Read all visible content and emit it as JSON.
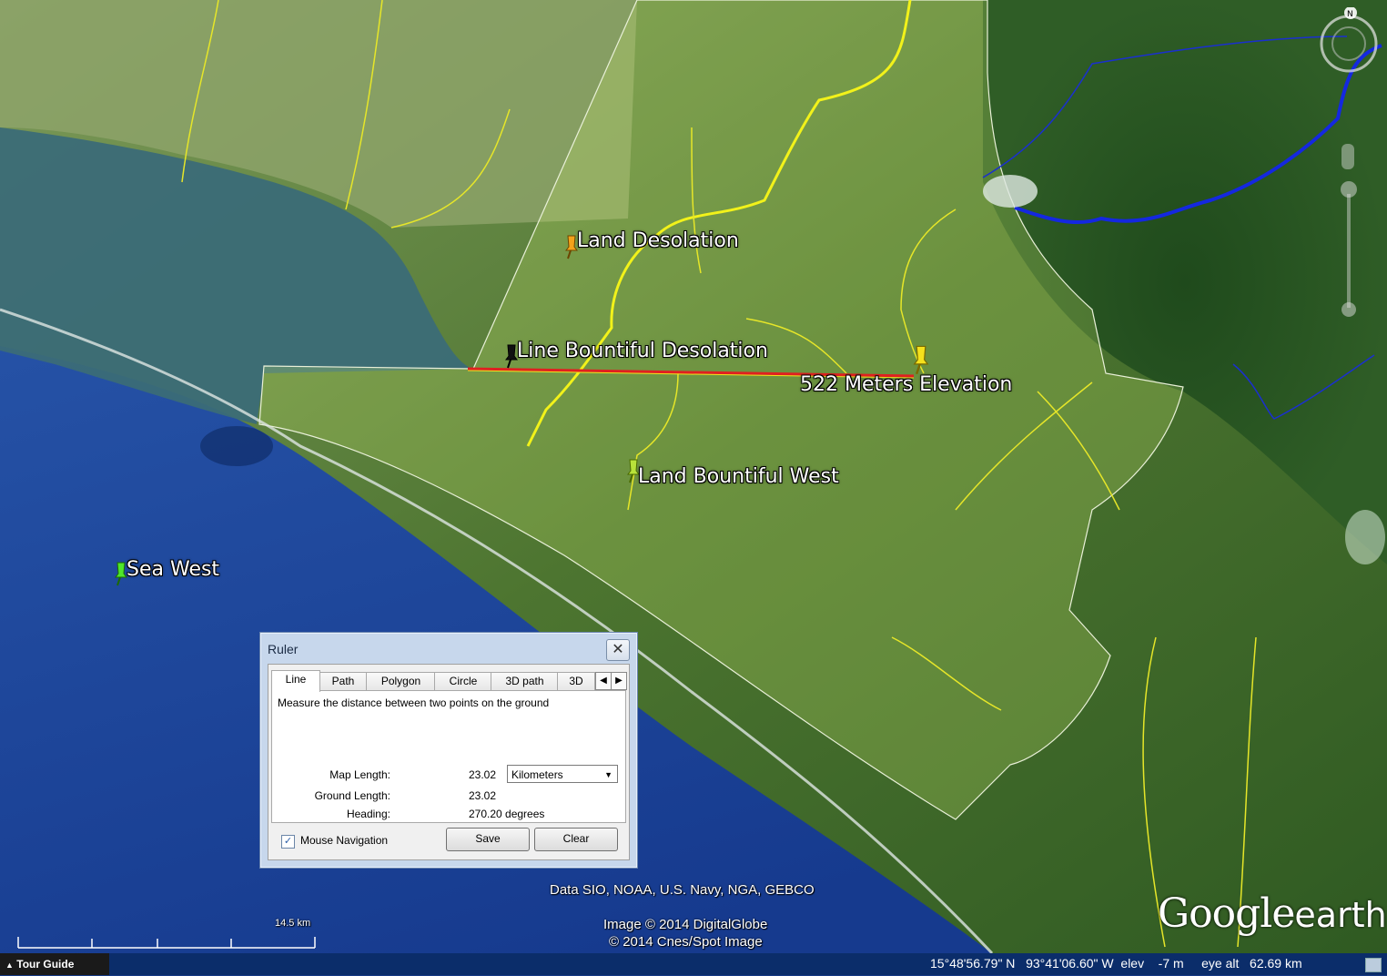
{
  "placemarks": {
    "land_desolation": "Land Desolation",
    "line_bountiful_desolation": "Line Bountiful Desolation",
    "elevation": "522 Meters Elevation",
    "land_bountiful_west": "Land Bountiful West",
    "sea_west": "Sea West"
  },
  "pin_colors": {
    "land_desolation": "#f3a21b",
    "line_bountiful_desolation": "#111111",
    "elevation": "#f5e11c",
    "land_bountiful_west": "#b8e23a",
    "sea_west": "#4ee62a"
  },
  "ruler": {
    "title": "Ruler",
    "close_icon": "close-icon",
    "tabs": [
      "Line",
      "Path",
      "Polygon",
      "Circle",
      "3D path",
      "3D"
    ],
    "active_tab": "Line",
    "description": "Measure the distance between two points on the ground",
    "map_length_label": "Map Length:",
    "map_length_value": "23.02",
    "unit_selected": "Kilometers",
    "ground_length_label": "Ground Length:",
    "ground_length_value": "23.02",
    "heading_label": "Heading:",
    "heading_value": "270.20 degrees",
    "mouse_navigation_label": "Mouse Navigation",
    "mouse_navigation_checked": true,
    "save_label": "Save",
    "clear_label": "Clear"
  },
  "credits": {
    "data": "Data SIO, NOAA, U.S. Navy, NGA, GEBCO",
    "image1": "Image © 2014 DigitalGlobe",
    "image2": "© 2014 Cnes/Spot Image"
  },
  "scale_label": "14.5 km",
  "logo": {
    "google": "Google",
    "earth": "earth"
  },
  "tour_guide": "Tour Guide",
  "status": {
    "lat": "15°48'56.79\" N",
    "lon": "93°41'06.60\" W",
    "elev_label": "elev",
    "elev_value": "-7 m",
    "eye_label": "eye alt",
    "eye_value": "62.69 km"
  },
  "colors": {
    "ocean": "#1d46a5",
    "land": "#4f7a2c",
    "region_highlight": "#c8e86a",
    "river_blue": "#1428e0",
    "river_yellow": "#f2f21a",
    "ruler_line": "#e02020"
  }
}
